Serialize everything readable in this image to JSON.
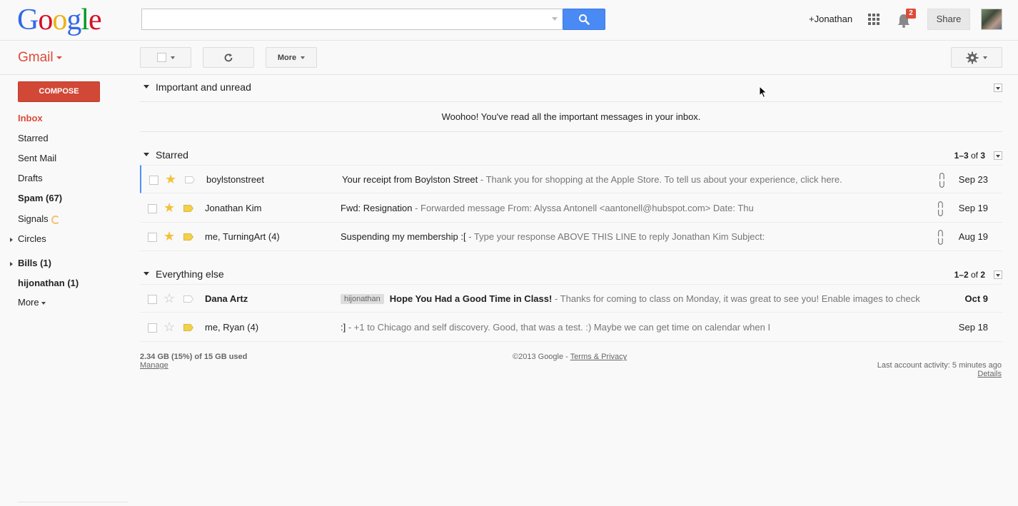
{
  "header": {
    "logo_letters": [
      {
        "ch": "G",
        "color": "#3369e8"
      },
      {
        "ch": "o",
        "color": "#d50f25"
      },
      {
        "ch": "o",
        "color": "#eeb211"
      },
      {
        "ch": "g",
        "color": "#3369e8"
      },
      {
        "ch": "l",
        "color": "#009925"
      },
      {
        "ch": "e",
        "color": "#d50f25"
      }
    ],
    "search_value": "",
    "search_placeholder": "",
    "search_icon": "search-icon",
    "user_name": "+Jonathan",
    "apps_icon": "apps-grid-icon",
    "notification_count": "2",
    "share_label": "Share",
    "avatar_icon": "avatar"
  },
  "toolbar": {
    "app_label": "Gmail",
    "more_label": "More",
    "refresh_icon": "refresh-icon",
    "settings_icon": "gear-icon"
  },
  "sidebar": {
    "compose_label": "COMPOSE",
    "items": [
      {
        "label": "Inbox"
      },
      {
        "label": "Starred"
      },
      {
        "label": "Sent Mail"
      },
      {
        "label": "Drafts"
      },
      {
        "label": "Spam (67)"
      },
      {
        "label": "Signals"
      },
      {
        "label": "Circles"
      },
      {
        "label": "Bills (1)"
      },
      {
        "label": "hijonathan (1)"
      },
      {
        "label": "More"
      }
    ]
  },
  "sections": {
    "important": {
      "title": "Important and unread",
      "empty_message": "Woohoo! You've read all the important messages in your inbox."
    },
    "starred": {
      "title": "Starred",
      "count_range": "1–3",
      "count_of": " of ",
      "count_total": "3",
      "rows": [
        {
          "sender": "boylstonstreet",
          "subject": "Your receipt from Boylston Street",
          "snippet": " - Thank you for shopping at the Apple Store. To tell us about your experience, click here.",
          "date": "Sep 23",
          "attachment": true
        },
        {
          "sender": "Jonathan Kim",
          "subject": "Fwd: Resignation",
          "snippet": " -  Forwarded message From: Alyssa Antonell <aantonell@hubspot.com> Date: Thu",
          "date": "Sep 19",
          "attachment": true
        },
        {
          "sender": "me, TurningArt (4)",
          "subject": "Suspending my membership :[",
          "snippet": " -  Type your response ABOVE THIS LINE to reply Jonathan Kim Subject:",
          "date": "Aug 19",
          "attachment": true
        }
      ]
    },
    "everything": {
      "title": "Everything else",
      "count_range": "1–2",
      "count_of": " of ",
      "count_total": "2",
      "rows": [
        {
          "sender": "Dana Artz",
          "label": "hijonathan",
          "subject": "Hope You Had a Good Time in Class!",
          "snippet": " - Thanks for coming to class on Monday, it was great to see you! Enable images to check",
          "date": "Oct 9"
        },
        {
          "sender": "me, Ryan (4)",
          "subject": ":]",
          "snippet": " - +1 to Chicago and self discovery. Good, that was a test. :) Maybe we can get time on calendar when I",
          "date": "Sep 18"
        }
      ]
    }
  },
  "footer": {
    "storage": "2.34 GB (15%) of 15 GB used",
    "manage": "Manage",
    "copyright": "©2013 Google - ",
    "terms": "Terms & Privacy",
    "activity": "Last account activity: 5 minutes ago",
    "details": "Details"
  },
  "colors": {
    "brand_red": "#dd4b39",
    "compose_red": "#d14836",
    "search_blue": "#4a8af4",
    "star_yellow": "#f3c138",
    "important_yellow": "#f2d04b"
  }
}
